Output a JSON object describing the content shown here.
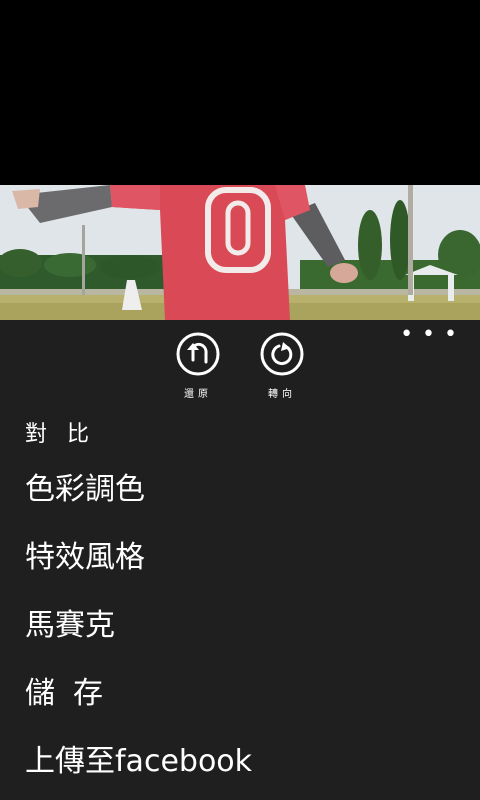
{
  "toolbar": {
    "undo_label": "還原",
    "rotate_label": "轉向",
    "more_label": "..."
  },
  "menu": {
    "items": [
      {
        "label": "對比"
      },
      {
        "label": "色彩調色"
      },
      {
        "label": "特效風格"
      },
      {
        "label": "馬賽克"
      },
      {
        "label": "儲存"
      },
      {
        "label": "上傳至facebook"
      }
    ]
  },
  "icons": [
    "undo-icon",
    "rotate-icon",
    "more-icon"
  ]
}
